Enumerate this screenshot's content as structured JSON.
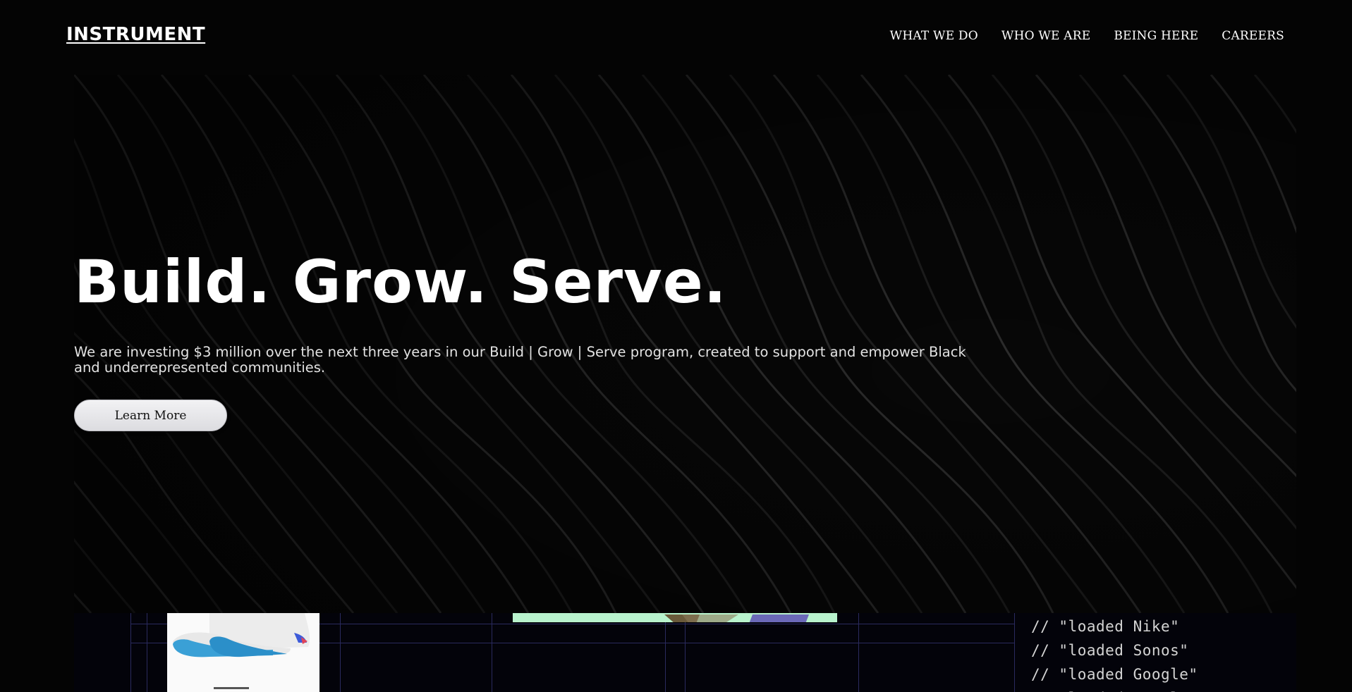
{
  "header": {
    "logo": "INSTRUMENT",
    "nav": [
      "WHAT WE DO",
      "WHO WE ARE",
      "BEING HERE",
      "CAREERS"
    ]
  },
  "hero": {
    "title": "Build. Grow. Serve.",
    "body": "We are investing $3 million over the next three years in our Build | Grow | Serve program, created to support and empower Black and underrepresented communities.",
    "cta_label": "Learn More"
  },
  "showcase": {
    "code_lines": [
      "// \"loaded Nike\"",
      "// \"loaded Sonos\"",
      "// \"loaded Google\"",
      "// \"loaded Intel\""
    ]
  },
  "colors": {
    "background": "#040404",
    "text": "#ffffff",
    "button": "#e6e6ea",
    "grid_line": "#2a2a5e",
    "accent_green": "#b8f3cd",
    "accent_purple": "#6b69b8"
  }
}
